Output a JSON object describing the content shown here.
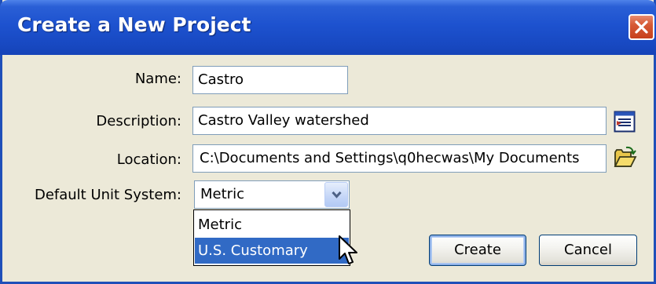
{
  "window": {
    "title": "Create a New Project"
  },
  "form": {
    "name_label": "Name:",
    "name_value": "Castro",
    "description_label": "Description:",
    "description_value": "Castro Valley watershed",
    "location_label": "Location:",
    "location_value": "C:\\Documents and Settings\\q0hecwas\\My Documents",
    "unit_label": "Default Unit System:",
    "unit_value": "Metric",
    "unit_options": [
      "Metric",
      "U.S. Customary"
    ]
  },
  "buttons": {
    "create": "Create",
    "cancel": "Cancel"
  },
  "icons": {
    "close": "close-icon",
    "description_button": "text-editor-icon",
    "location_button": "open-folder-icon",
    "dropdown": "chevron-down-icon",
    "cursor": "mouse-pointer-icon"
  },
  "colors": {
    "titlebar": "#1d52cf",
    "dialog_bg": "#ece9d8",
    "selection": "#316ac5",
    "close_button": "#d65a35"
  }
}
